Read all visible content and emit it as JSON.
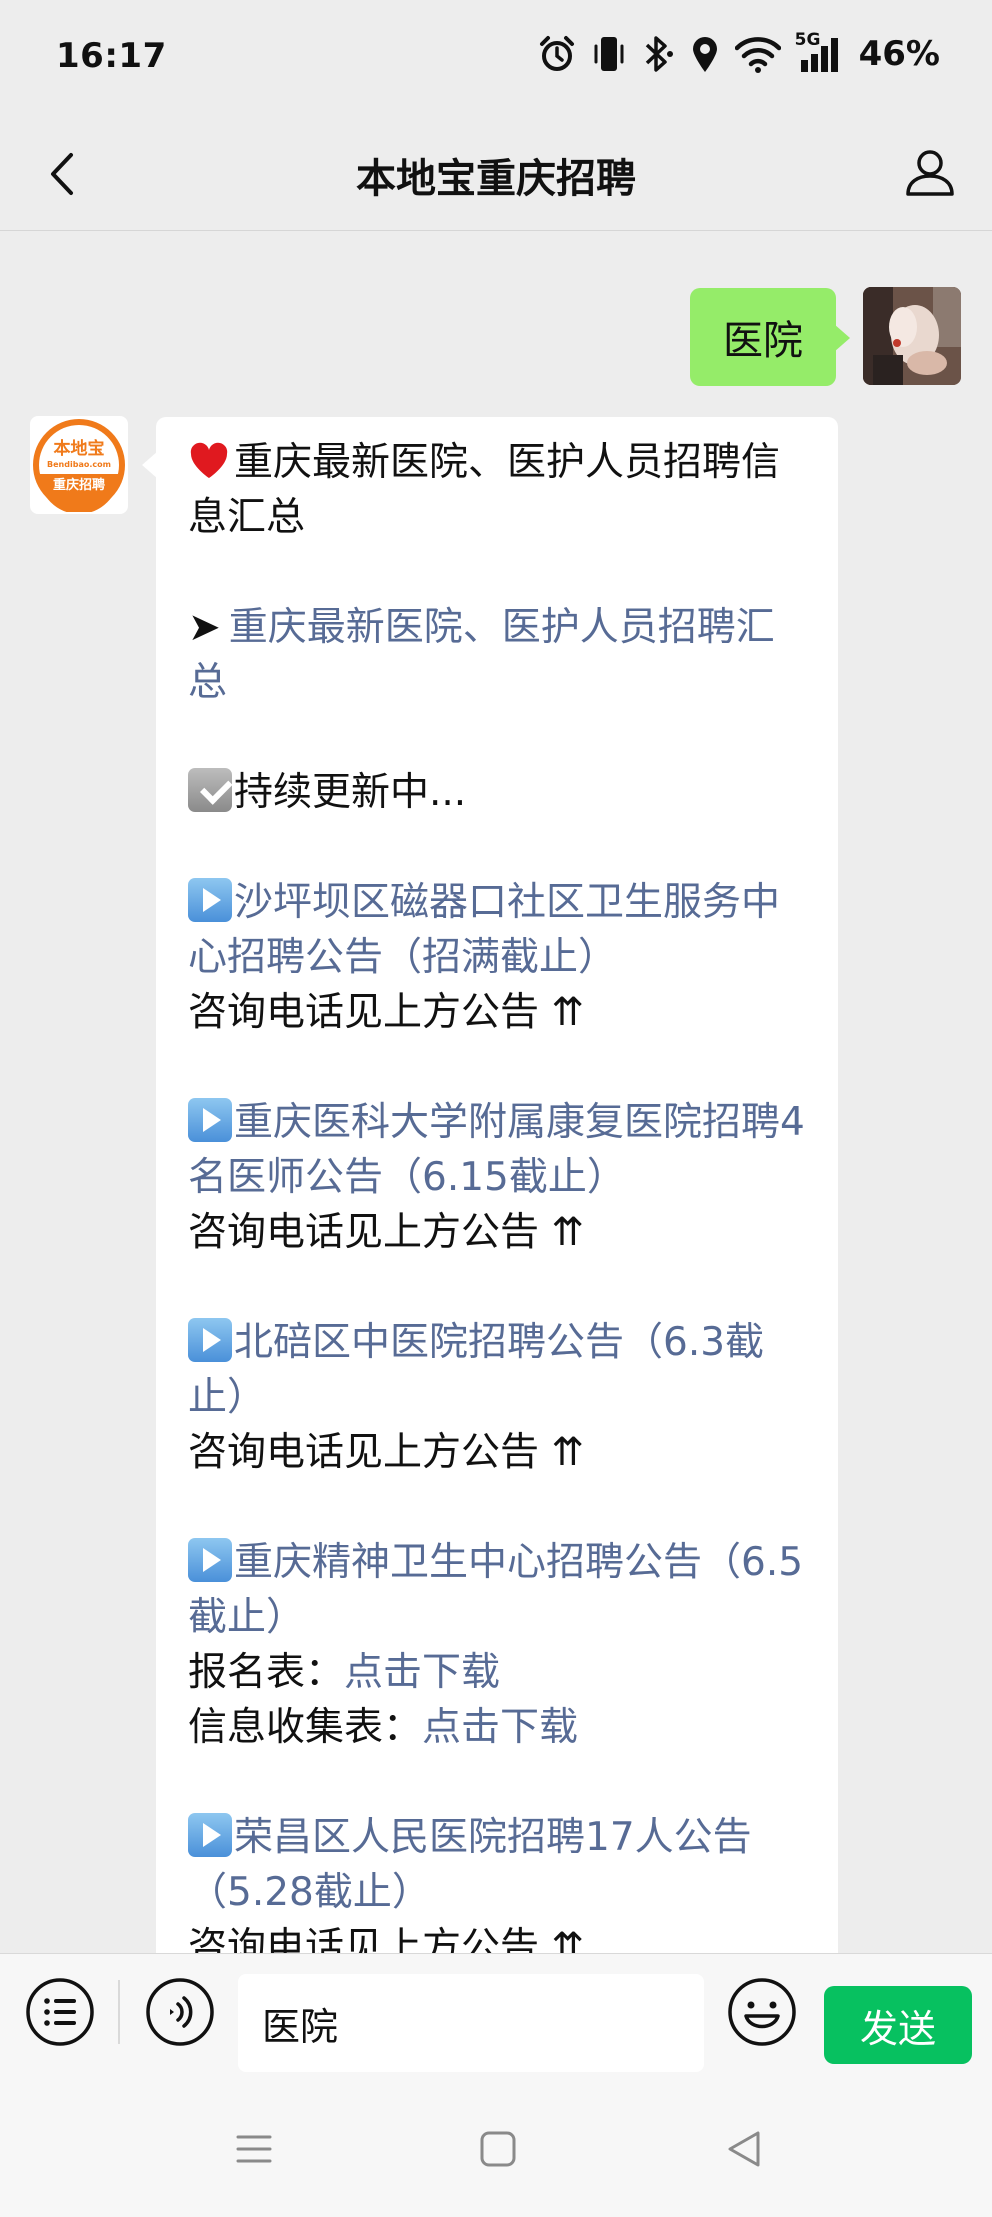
{
  "status_bar": {
    "time": "16:17",
    "battery": "46%",
    "network": "5G",
    "icons": [
      "alarm-icon",
      "vibrate-icon",
      "bluetooth-icon",
      "location-icon",
      "wifi-icon",
      "cellular-signal-icon",
      "battery-icon"
    ]
  },
  "header": {
    "title": "本地宝重庆招聘",
    "back_icon": "chevron-left-icon",
    "profile_icon": "user-profile-icon"
  },
  "conversation": {
    "user_message": "医院",
    "bot_logo": {
      "name": "本地宝",
      "domain": "Bendibao.com",
      "tagline": "重庆招聘"
    },
    "bot_message": {
      "headline": "重庆最新医院、医护人员招聘信息汇总",
      "summary_link": "重庆最新医院、医护人员招聘汇总",
      "status_text": "持续更新中...",
      "items": [
        {
          "title": "沙坪坝区磁器口社区卫生服务中心招聘公告（招满截止）",
          "note": "咨询电话见上方公告 ⇈"
        },
        {
          "title": "重庆医科大学附属康复医院招聘4名医师公告（6.15截止）",
          "note": "咨询电话见上方公告 ⇈"
        },
        {
          "title": "北碚区中医院招聘公告（6.3截止）",
          "note": "咨询电话见上方公告 ⇈"
        },
        {
          "title": "重庆精神卫生中心招聘公告（6.5截止）",
          "form_label_1": "报名表：",
          "form_link_1": "点击下载",
          "form_label_2": "信息收集表：",
          "form_link_2": "点击下载"
        },
        {
          "title": "荣昌区人民医院招聘17人公告（5.28截止）",
          "note": "咨询电话见上方公告 ⇈"
        }
      ]
    }
  },
  "input_bar": {
    "input_value": "医院",
    "send_label": "发送"
  },
  "colors": {
    "background": "#ededed",
    "user_bubble": "#95ec69",
    "link": "#576b95",
    "send_button": "#07c160",
    "logo_orange": "#f07a1a"
  }
}
